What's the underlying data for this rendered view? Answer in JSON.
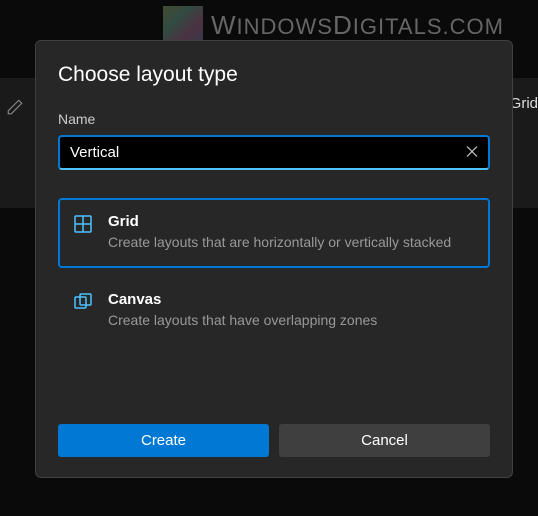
{
  "watermark": "WindowsDigitals.com",
  "background": {
    "grid_label": "Grid"
  },
  "dialog": {
    "title": "Choose layout type",
    "name_label": "Name",
    "name_value": "Vertical",
    "options": [
      {
        "title": "Grid",
        "description": "Create layouts that are horizontally or vertically stacked",
        "selected": true
      },
      {
        "title": "Canvas",
        "description": "Create layouts that have overlapping zones",
        "selected": false
      }
    ],
    "buttons": {
      "primary": "Create",
      "secondary": "Cancel"
    }
  }
}
